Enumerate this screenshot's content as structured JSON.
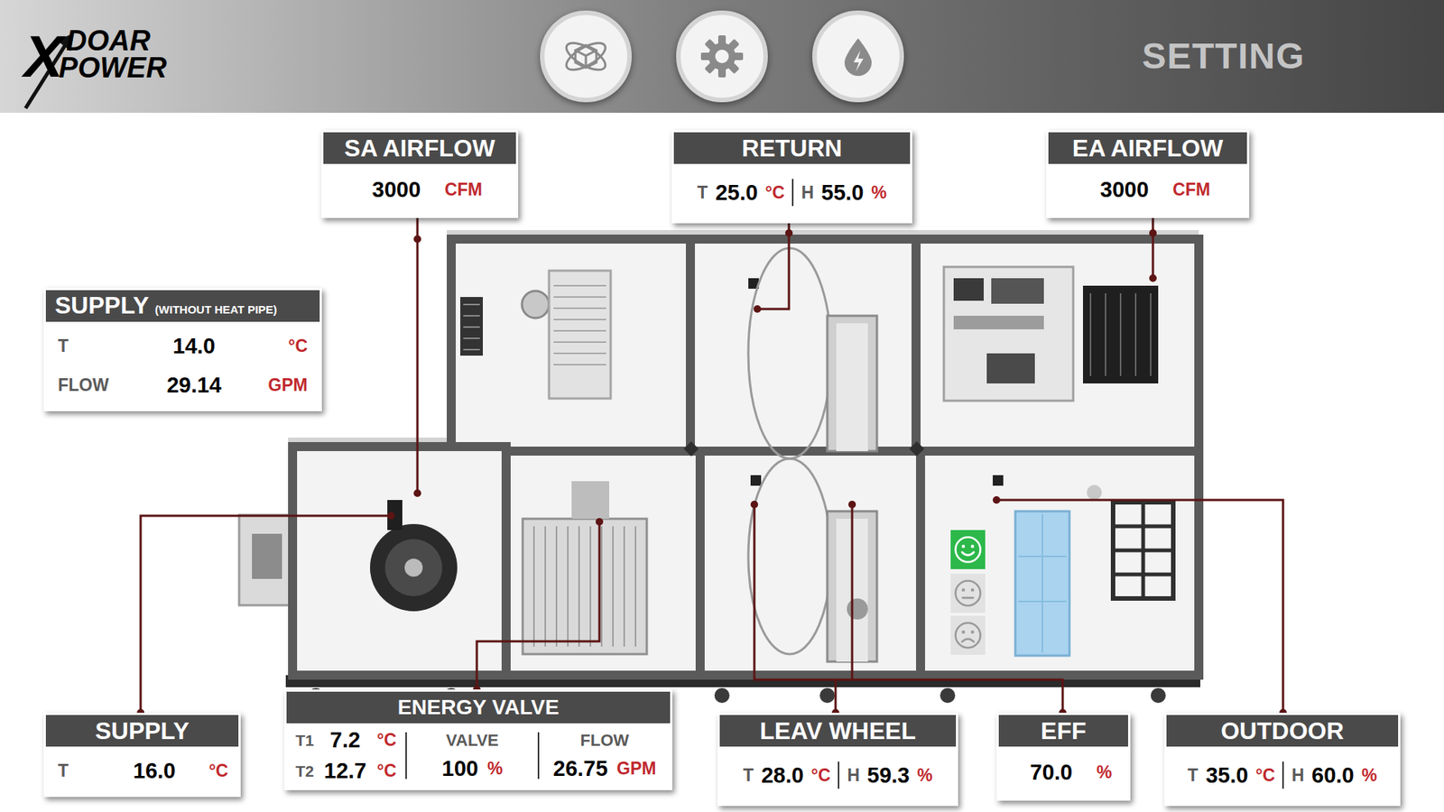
{
  "header": {
    "logo_mark": "X",
    "logo_top": "DOAR",
    "logo_bottom": "POWER",
    "title": "SETTING"
  },
  "panels": [
    {
      "kind": "single",
      "title": "SA AIRFLOW",
      "value": "3000",
      "unit": "CFM"
    },
    {
      "kind": "pair",
      "title": "RETURN",
      "items": [
        {
          "label": "T",
          "value": "25.0",
          "unit": "°C"
        },
        {
          "label": "H",
          "value": "55.0",
          "unit": "%"
        }
      ]
    },
    {
      "kind": "single",
      "title": "EA AIRFLOW",
      "value": "3000",
      "unit": "CFM"
    },
    {
      "kind": "labeled",
      "title": "SUPPLY",
      "subtitle": "(WITHOUT HEAT PIPE)",
      "rows": [
        {
          "label": "T",
          "value": "14.0",
          "unit": "°C"
        },
        {
          "label": "FLOW",
          "value": "29.14",
          "unit": "GPM"
        }
      ]
    },
    {
      "kind": "labeled",
      "title": "SUPPLY",
      "subtitle": "",
      "rows": [
        {
          "label": "T",
          "value": "16.0",
          "unit": "°C"
        }
      ]
    },
    {
      "kind": "valve",
      "title": "ENERGY VALVE",
      "temps": [
        {
          "label": "T1",
          "value": "7.2",
          "unit": "°C"
        },
        {
          "label": "T2",
          "value": "12.7",
          "unit": "°C"
        }
      ],
      "valve": {
        "label": "VALVE",
        "value": "100",
        "unit": "%"
      },
      "flow": {
        "label": "FLOW",
        "value": "26.75",
        "unit": "GPM"
      }
    },
    {
      "kind": "pair",
      "title": "LEAV WHEEL",
      "items": [
        {
          "label": "T",
          "value": "28.0",
          "unit": "°C"
        },
        {
          "label": "H",
          "value": "59.3",
          "unit": "%"
        }
      ]
    },
    {
      "kind": "single",
      "title": "EFF",
      "value": "70.0",
      "unit": "%"
    },
    {
      "kind": "pair",
      "title": "OUTDOOR",
      "items": [
        {
          "label": "T",
          "value": "35.0",
          "unit": "°C"
        },
        {
          "label": "H",
          "value": "60.0",
          "unit": "%"
        }
      ]
    }
  ],
  "eff_indicator": [
    {
      "kind": "happy",
      "selected": true
    },
    {
      "kind": "neutral",
      "selected": false
    },
    {
      "kind": "sad",
      "selected": false
    }
  ]
}
